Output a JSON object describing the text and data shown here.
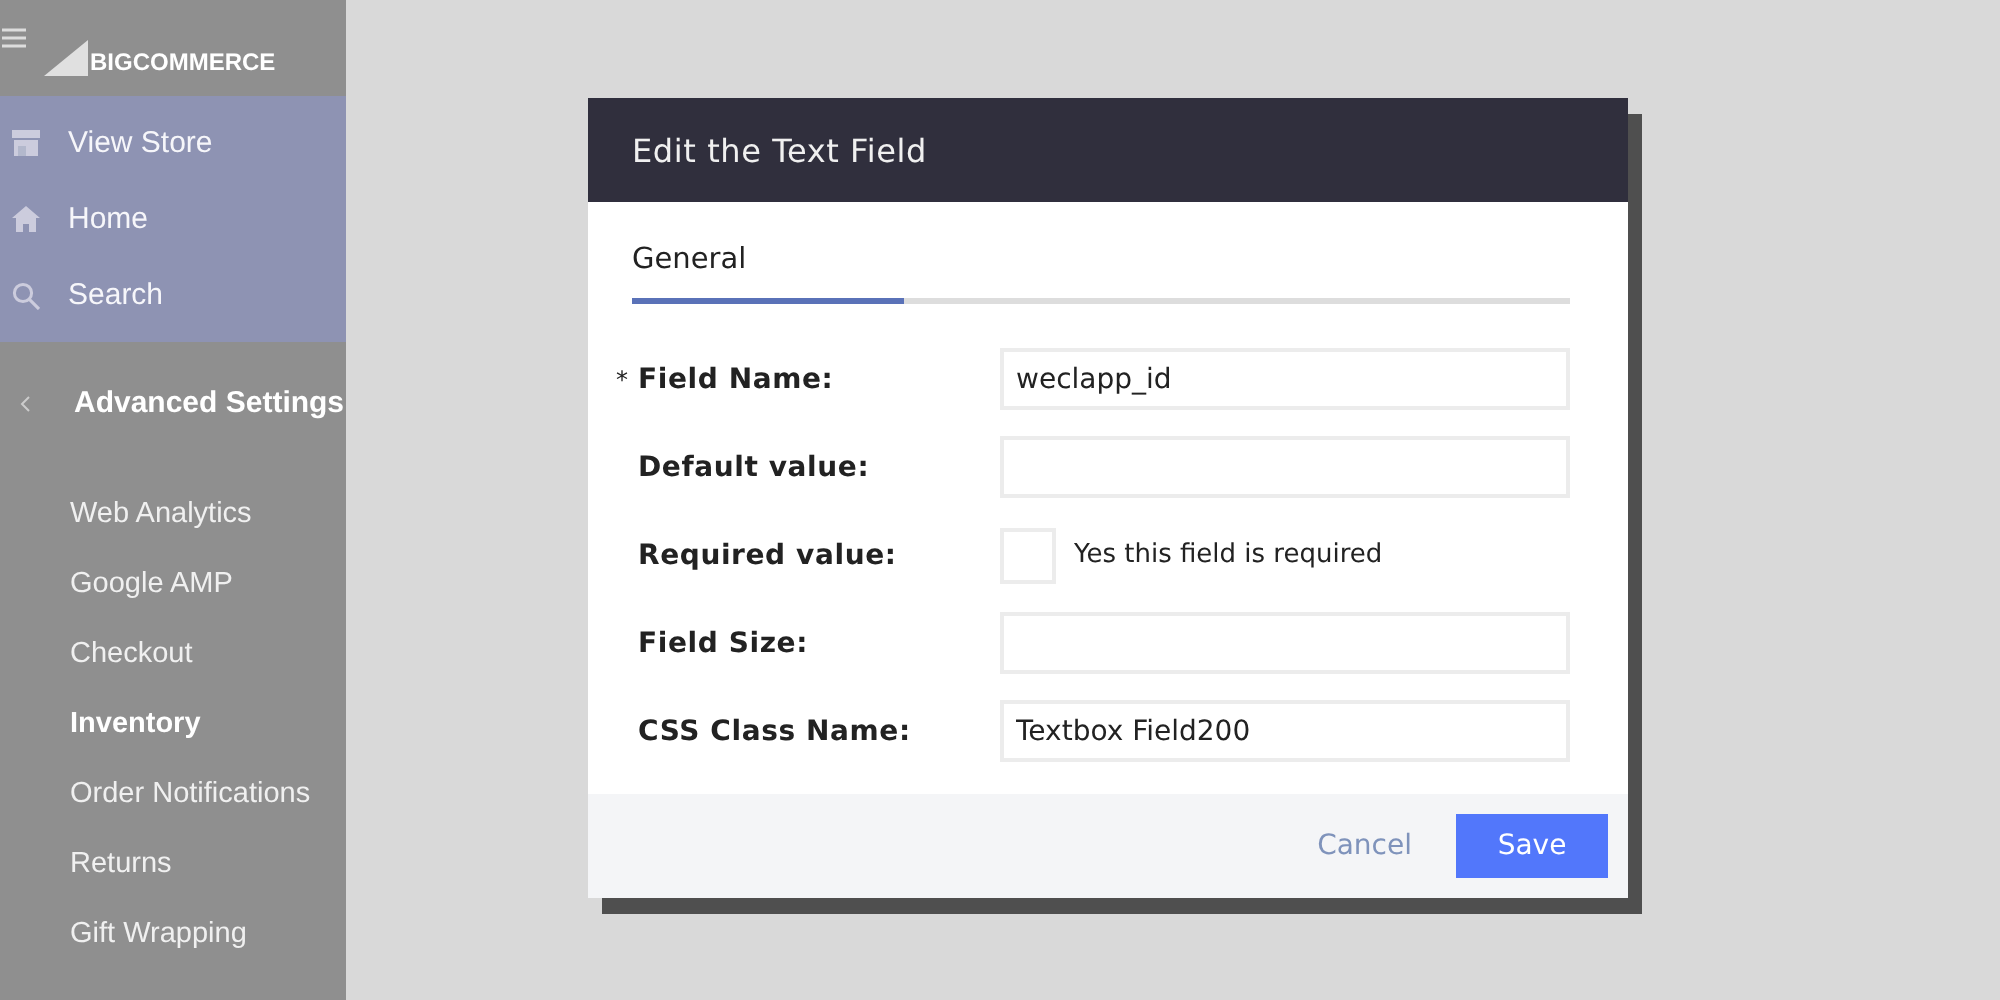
{
  "sidebar": {
    "logo": "BIGCOMMERCE",
    "quick_links": [
      {
        "label": "View Store"
      },
      {
        "label": "Home"
      },
      {
        "label": "Search"
      }
    ],
    "section": "Advanced Settings",
    "items": [
      {
        "label": "Web Analytics",
        "selected": false
      },
      {
        "label": "Google AMP",
        "selected": false
      },
      {
        "label": "Checkout",
        "selected": false
      },
      {
        "label": "Inventory",
        "selected": true
      },
      {
        "label": "Order Notifications",
        "selected": false
      },
      {
        "label": "Returns",
        "selected": false
      },
      {
        "label": "Gift Wrapping",
        "selected": false
      }
    ]
  },
  "dialog": {
    "title": "Edit the Text Field",
    "tabs": [
      {
        "label": "General",
        "selected": true
      }
    ],
    "progress": {
      "level": 0.29
    },
    "fields": [
      {
        "kind": "text",
        "marker": "*",
        "label": "Field Name:",
        "value": "weclapp_id"
      },
      {
        "kind": "text",
        "label": "Default value:"
      },
      {
        "kind": "checkbox",
        "label": "Required value:",
        "checked": false,
        "option": "Yes this field is required"
      },
      {
        "kind": "text",
        "label": "Field Size:"
      },
      {
        "kind": "text",
        "label": "CSS Class Name:",
        "value": "Textbox Field200"
      }
    ],
    "buttons": [
      {
        "label": "Cancel",
        "kind": "secondary"
      },
      {
        "label": "Save",
        "kind": "primary"
      }
    ]
  }
}
